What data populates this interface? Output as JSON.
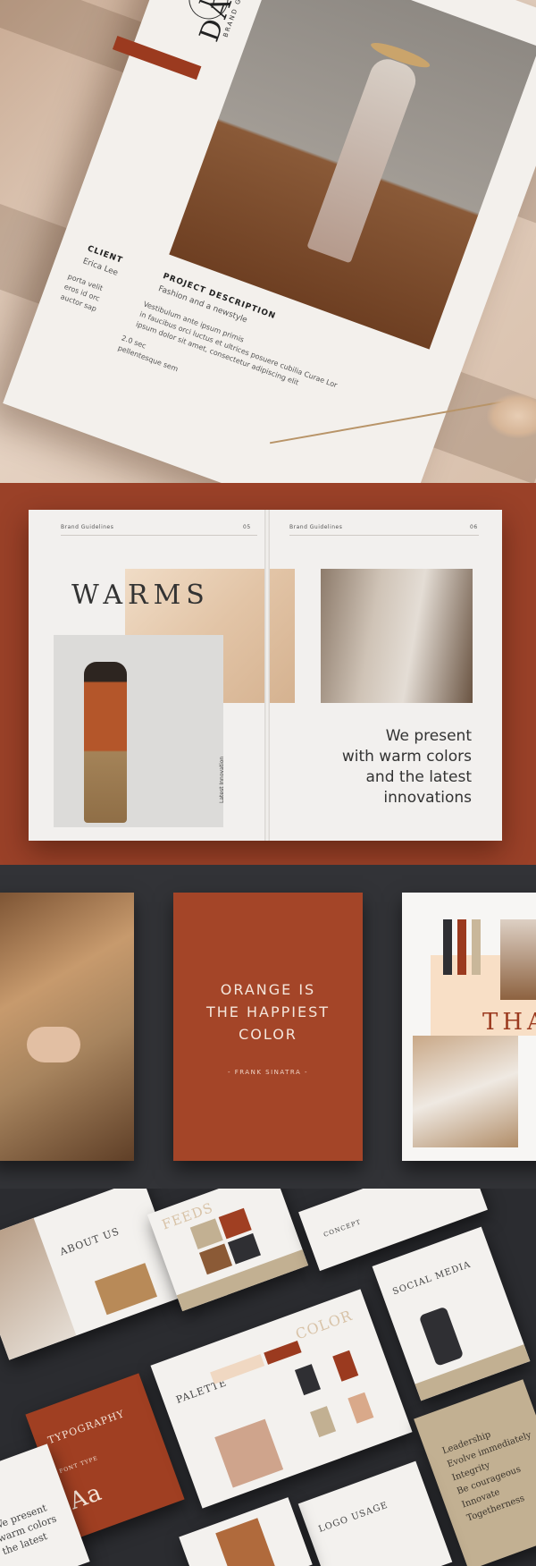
{
  "cover": {
    "logo_letter": "D",
    "brand": "DARCY",
    "brand_sub": "BRAND GUIDELINES",
    "client_label": "CLIENT",
    "client_name": "Erica Lee",
    "client_lines": [
      "porta velit",
      "eros id orc",
      "auctor sap"
    ],
    "project_label": "PROJECT DESCRIPTION",
    "project_sub": "Fashion and a newstyle",
    "project_lines": [
      "Vestibulum ante ipsum primis",
      "in faucibus orci luctus et ultrices posuere cubilia Curae Lor",
      "ipsum dolor sit amet, consectetur adipiscing elit"
    ],
    "extra_lines": [
      "2.0 sec",
      "pellentesque sem"
    ]
  },
  "magazine": {
    "left_header": "Brand Guidelines",
    "left_page": "05",
    "right_header": "Brand Guidelines",
    "right_page": "06",
    "headline": "WARMS",
    "vertical_label": "Latest Innovation",
    "quote_lines": [
      "We present",
      "with warm colors",
      "and the latest",
      "innovations"
    ]
  },
  "quote_card": {
    "lines": [
      "ORANGE IS",
      "THE HAPPIEST",
      "COLOR"
    ],
    "attribution": "-  FRANK SINATRA  -"
  },
  "swatch_card": {
    "headline": "THA",
    "swatches": [
      "#2f2f33",
      "#9b3a1f",
      "#c9b79a"
    ]
  },
  "spreads": {
    "about": "ABOUT US",
    "feeds": "FEEDS",
    "concept": "CONCEPT",
    "social": "SOCIAL MEDIA",
    "typography": "TYPOGRAPHY",
    "typeface_label": "FONT TYPE",
    "sample": "Aa",
    "palette": "PALETTE",
    "color": "COLOR",
    "logo_usage": "LOGO USAGE",
    "values": [
      "Leadership",
      "Evolve immediately",
      "Integrity",
      "Be courageous",
      "Innovate",
      "Togetherness"
    ],
    "left_quote": [
      "We present",
      "warm colors",
      "the latest"
    ]
  },
  "colors": {
    "rust": "#9b3a1f",
    "charcoal": "#2f3034",
    "paper": "#f3f0ec"
  }
}
